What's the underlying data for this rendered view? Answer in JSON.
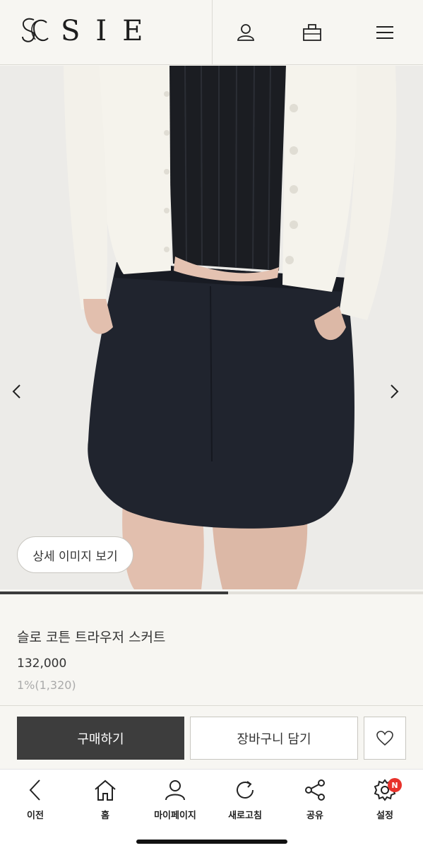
{
  "header": {
    "brand": "SIE",
    "icons": [
      "user-icon",
      "shopping-bag-icon",
      "menu-icon"
    ]
  },
  "hero": {
    "detail_button_label": "상세 이미지 보기",
    "slide_progress": 0.54
  },
  "product": {
    "name": "슬로 코튼 트라우저 스커트",
    "price": "132,000",
    "points": "1%(1,320)"
  },
  "actions": {
    "buy_label": "구매하기",
    "cart_label": "장바구니 담기",
    "wish_icon": "heart-icon"
  },
  "bottom_nav": {
    "back": "이전",
    "home": "홈",
    "mypage": "마이페이지",
    "refresh": "새로고침",
    "share": "공유",
    "settings": "설정",
    "settings_badge": "N"
  },
  "colors": {
    "background": "#f7f6f2",
    "buy_button": "#3d3d3d",
    "badge": "#e8322b"
  }
}
